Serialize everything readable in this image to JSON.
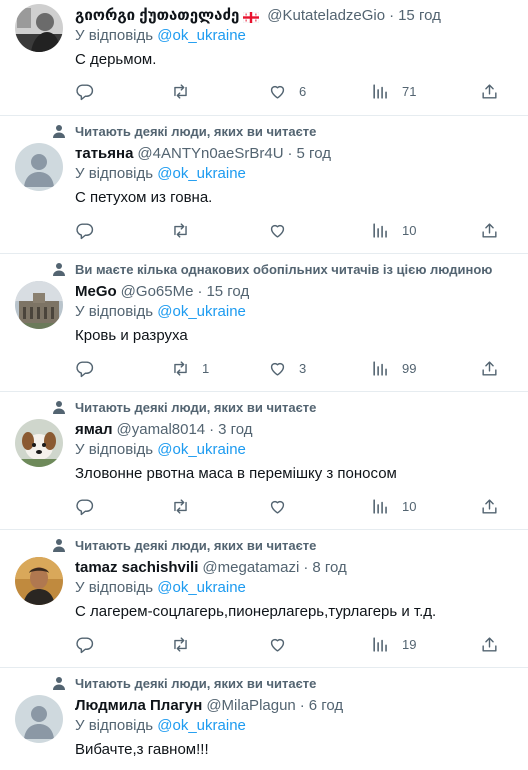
{
  "tweets": [
    {
      "social": "",
      "name": "გიორგი ქუთათელაძე",
      "flag": true,
      "handle": "@KutateladzeGio",
      "dot": "·",
      "time": "15 год",
      "reply_prefix": "У відповідь",
      "mention": "@ok_ukraine",
      "text": "С дерьмом.",
      "replies": "",
      "retweets": "",
      "likes": "6",
      "views": "71",
      "avatar": "photo-man-dark"
    },
    {
      "social": "Читають деякі люди, яких ви читаєте",
      "name": "татьяна",
      "flag": false,
      "handle": "@4ANTYn0aeSrBr4U",
      "dot": "·",
      "time": "5 год",
      "reply_prefix": "У відповідь",
      "mention": "@ok_ukraine",
      "text": "С петухом из говна.",
      "replies": "",
      "retweets": "",
      "likes": "",
      "views": "10",
      "avatar": "default-avatar"
    },
    {
      "social": "Ви маєте кілька однакових обопільних читачів із цією людиною",
      "name": "MeGo",
      "flag": false,
      "handle": "@Go65Me",
      "dot": "·",
      "time": "15 год",
      "reply_prefix": "У відповідь",
      "mention": "@ok_ukraine",
      "text": "Кровь и разруха",
      "replies": "",
      "retweets": "1",
      "likes": "3",
      "views": "99",
      "avatar": "photo-building"
    },
    {
      "social": "Читають деякі люди, яких ви читаєте",
      "name": "ямал",
      "flag": false,
      "handle": "@yamal8014",
      "dot": "·",
      "time": "3 год",
      "reply_prefix": "У відповідь",
      "mention": "@ok_ukraine",
      "text": "Зловонне рвотна маса в перемішку з поносом",
      "replies": "",
      "retweets": "",
      "likes": "",
      "views": "10",
      "avatar": "photo-dog"
    },
    {
      "social": "Читають деякі люди, яких ви читаєте",
      "name": "tamaz sachishvili",
      "flag": false,
      "handle": "@megatamazi",
      "dot": "·",
      "time": "8 год",
      "reply_prefix": "У відповідь",
      "mention": "@ok_ukraine",
      "text": "С лагерем-соцлагерь,пионерлагерь,турлагерь и т.д.",
      "replies": "",
      "retweets": "",
      "likes": "",
      "views": "19",
      "avatar": "photo-man-warm"
    },
    {
      "social": "Читають деякі люди, яких ви читаєте",
      "name": "Людмила Плагун",
      "flag": false,
      "handle": "@MilaPlagun",
      "dot": "·",
      "time": "6 год",
      "reply_prefix": "У відповідь",
      "mention": "@ok_ukraine",
      "text": "Вибачте,з гавном!!!",
      "replies": "",
      "retweets": "",
      "likes": "",
      "views": "",
      "avatar": "default-avatar"
    }
  ],
  "icons": {
    "reply": "reply-icon",
    "retweet": "retweet-icon",
    "like": "like-icon",
    "views": "views-icon",
    "share": "share-icon",
    "social": "person-icon"
  },
  "colors": {
    "text": "#0f1419",
    "secondary": "#536471",
    "mention": "#1d9bf0",
    "divider": "#e6ecf0"
  }
}
